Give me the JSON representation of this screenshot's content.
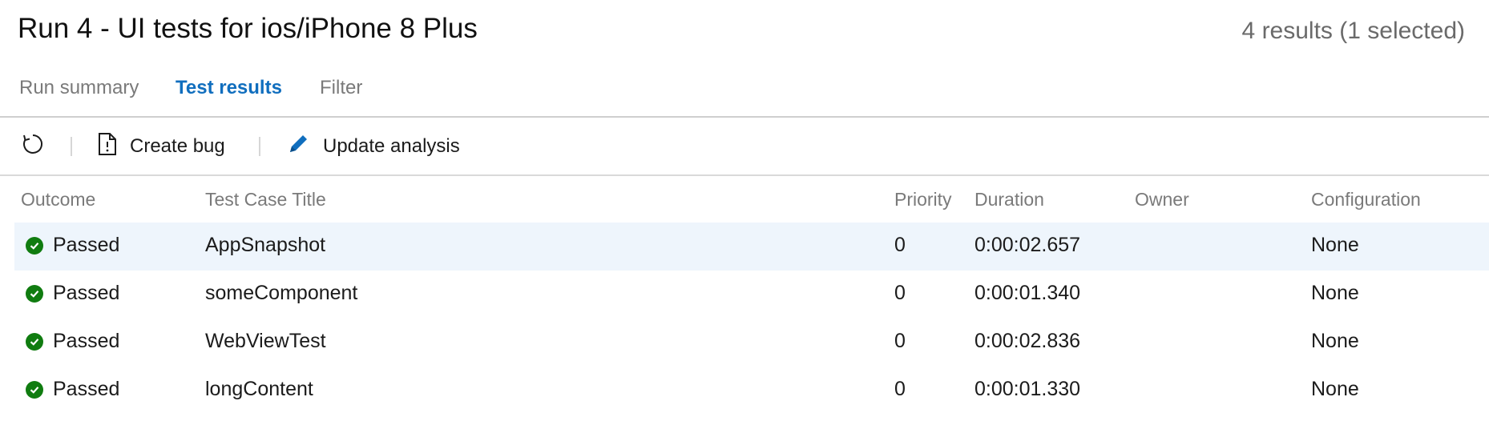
{
  "header": {
    "title": "Run 4 - UI tests for ios/iPhone 8 Plus",
    "result_count": "4 results (1 selected)"
  },
  "tabs": [
    {
      "label": "Run summary",
      "active": false
    },
    {
      "label": "Test results",
      "active": true
    },
    {
      "label": "Filter",
      "active": false
    }
  ],
  "toolbar": {
    "refresh_icon": "refresh-icon",
    "create_bug_label": "Create bug",
    "create_bug_icon": "document-warning-icon",
    "update_analysis_label": "Update analysis",
    "update_analysis_icon": "pencil-icon"
  },
  "table": {
    "columns": [
      "Outcome",
      "Test Case Title",
      "Priority",
      "Duration",
      "Owner",
      "Configuration"
    ],
    "rows": [
      {
        "outcome": "Passed",
        "title": "AppSnapshot",
        "priority": "0",
        "duration": "0:00:02.657",
        "owner": "",
        "configuration": "None",
        "selected": true
      },
      {
        "outcome": "Passed",
        "title": "someComponent",
        "priority": "0",
        "duration": "0:00:01.340",
        "owner": "",
        "configuration": "None",
        "selected": false
      },
      {
        "outcome": "Passed",
        "title": "WebViewTest",
        "priority": "0",
        "duration": "0:00:02.836",
        "owner": "",
        "configuration": "None",
        "selected": false
      },
      {
        "outcome": "Passed",
        "title": "longContent",
        "priority": "0",
        "duration": "0:00:01.330",
        "owner": "",
        "configuration": "None",
        "selected": false
      }
    ]
  },
  "colors": {
    "accent": "#106ebe",
    "passed": "#107c10",
    "selected_row": "#eef5fc"
  }
}
